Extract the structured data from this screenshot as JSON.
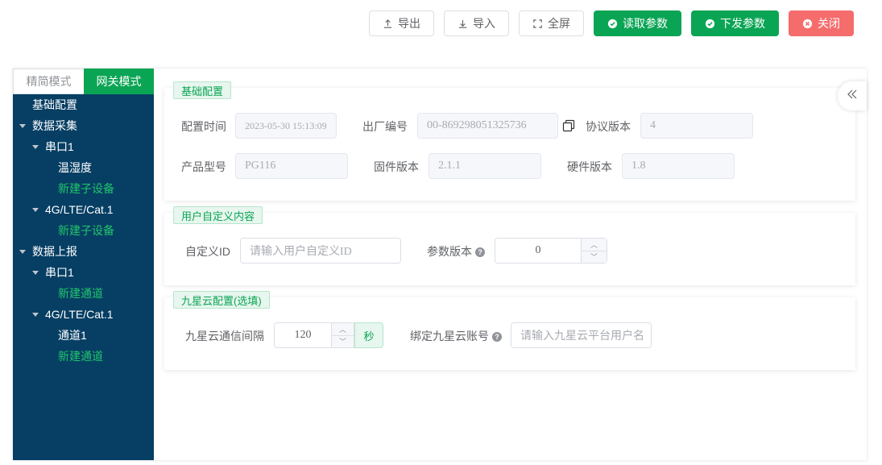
{
  "toolbar": {
    "export_label": "导出",
    "import_label": "导入",
    "fullscreen_label": "全屏",
    "read_label": "读取参数",
    "send_label": "下发参数",
    "close_label": "关闭"
  },
  "colors": {
    "accent": "#0aa554",
    "danger": "#f56c6c",
    "sidebar": "#073f64"
  },
  "sidebar": {
    "mode_simple": "精简模式",
    "mode_gateway": "网关模式",
    "active_mode": "网关模式",
    "tree": {
      "basic": "基础配置",
      "collect": "数据采集",
      "collect_serial": "串口1",
      "collect_serial_child": "温湿度",
      "collect_serial_new": "新建子设备",
      "collect_lte": "4G/LTE/Cat.1",
      "collect_lte_new": "新建子设备",
      "report": "数据上报",
      "report_serial": "串口1",
      "report_serial_new": "新建通道",
      "report_lte": "4G/LTE/Cat.1",
      "report_lte_child": "通道1",
      "report_lte_new": "新建通道"
    }
  },
  "basic": {
    "title": "基础配置",
    "config_time_label": "配置时间",
    "config_time_value": "2023-05-30 15:13:09",
    "serial_label": "出厂编号",
    "serial_value": "00-869298051325736",
    "protocol_label": "协议版本",
    "protocol_value": "4",
    "model_label": "产品型号",
    "model_value": "PG116",
    "firmware_label": "固件版本",
    "firmware_value": "2.1.1",
    "hardware_label": "硬件版本",
    "hardware_value": "1.8"
  },
  "custom": {
    "title": "用户自定义内容",
    "id_label": "自定义ID",
    "id_placeholder": "请输入用户自定义ID",
    "param_version_label": "参数版本",
    "param_version_value": "0"
  },
  "cloud": {
    "title": "九星云配置(选填)",
    "interval_label": "九星云通信间隔",
    "interval_value": "120",
    "interval_unit": "秒",
    "account_label": "绑定九星云账号",
    "account_placeholder": "请输入九星云平台用户名"
  },
  "icons": [
    "upload-icon",
    "download-icon",
    "fullscreen-icon",
    "check-circle-icon",
    "close-circle-icon",
    "copy-icon",
    "help-icon",
    "double-chevron-left-icon",
    "caret-down-icon"
  ]
}
